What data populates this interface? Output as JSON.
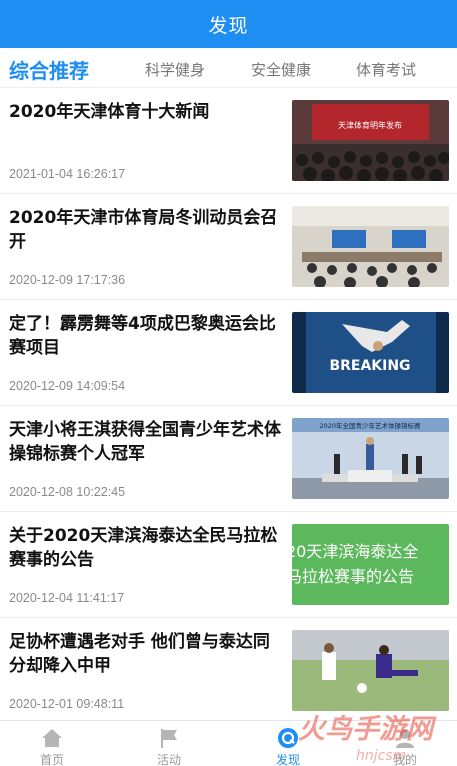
{
  "header": {
    "title": "发现"
  },
  "tabs": [
    {
      "label": "综合推荐",
      "active": true
    },
    {
      "label": "科学健身",
      "active": false
    },
    {
      "label": "安全健康",
      "active": false
    },
    {
      "label": "体育考试",
      "active": false
    }
  ],
  "news": [
    {
      "headline": "2020年天津体育十大新闻",
      "date": "2021-01-04 16:26:17",
      "thumb_text": "天津体育明年发布"
    },
    {
      "headline": "2020年天津市体育局冬训动员会召开",
      "date": "2020-12-09 17:17:36"
    },
    {
      "headline": "定了！霹雳舞等4项成巴黎奥运会比赛项目",
      "date": "2020-12-09 14:09:54",
      "thumb_text": "BREAKING"
    },
    {
      "headline": "天津小将王淇获得全国青少年艺术体操锦标赛个人冠军",
      "date": "2020-12-08 10:22:45",
      "thumb_text": "2020年全国青少年艺术体操锦标赛"
    },
    {
      "headline": "关于2020天津滨海泰达全民马拉松赛事的公告",
      "date": "2020-12-04 11:41:17",
      "thumb_text_line1": "20天津滨海泰达全",
      "thumb_text_line2": "马拉松赛事的公告"
    },
    {
      "headline": "足协杯遭遇老对手 他们曾与泰达同分却降入中甲",
      "date": "2020-12-01 09:48:11"
    }
  ],
  "tabbar": [
    {
      "label": "首页",
      "icon": "home-icon",
      "active": false
    },
    {
      "label": "活动",
      "icon": "flag-icon",
      "active": false
    },
    {
      "label": "发现",
      "icon": "discover-icon",
      "active": true
    },
    {
      "label": "我的",
      "icon": "user-icon",
      "active": false
    }
  ],
  "watermark": {
    "text": "火鸟手游网",
    "sub": "hnjcsm"
  },
  "colors": {
    "accent": "#1e8ef3",
    "marathon_green": "#5cb85c"
  }
}
